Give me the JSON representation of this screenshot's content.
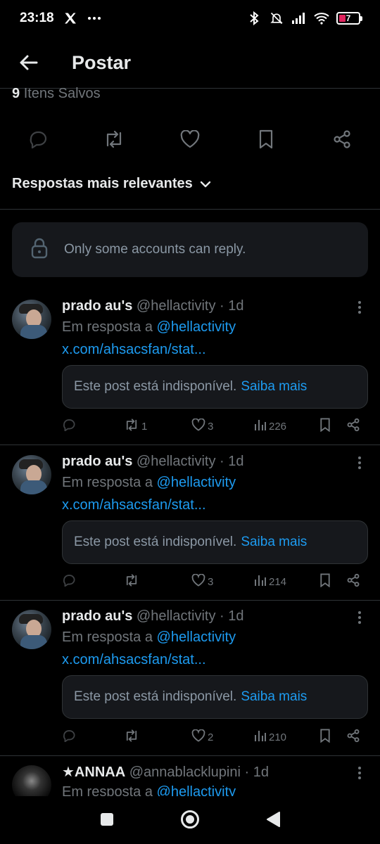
{
  "status_bar": {
    "time": "23:18",
    "battery_level": "7"
  },
  "header": {
    "title": "Postar"
  },
  "saved": {
    "count": "9",
    "label": "Itens Salvos"
  },
  "sort": {
    "label": "Respostas mais relevantes"
  },
  "restriction": {
    "text": "Only some accounts can reply."
  },
  "replies": [
    {
      "name": "prado au's",
      "handle": "@hellactivity",
      "dot": "·",
      "time": "1d",
      "reply_prefix": "Em resposta a",
      "reply_to": "@hellactivity",
      "link": "x.com/ahsacsfan/stat...",
      "unavailable_text": "Este post está indisponível.",
      "learn_more": "Saiba mais",
      "reposts": "1",
      "likes": "3",
      "views": "226"
    },
    {
      "name": "prado au's",
      "handle": "@hellactivity",
      "dot": "·",
      "time": "1d",
      "reply_prefix": "Em resposta a",
      "reply_to": "@hellactivity",
      "link": "x.com/ahsacsfan/stat...",
      "unavailable_text": "Este post está indisponível.",
      "learn_more": "Saiba mais",
      "reposts": "",
      "likes": "3",
      "views": "214"
    },
    {
      "name": "prado au's",
      "handle": "@hellactivity",
      "dot": "·",
      "time": "1d",
      "reply_prefix": "Em resposta a",
      "reply_to": "@hellactivity",
      "link": "x.com/ahsacsfan/stat...",
      "unavailable_text": "Este post está indisponível.",
      "learn_more": "Saiba mais",
      "reposts": "",
      "likes": "2",
      "views": "210"
    },
    {
      "name": "★ANNAA",
      "handle": "@annablacklupini",
      "dot": "·",
      "time": "1d",
      "reply_prefix": "Em resposta a",
      "reply_to": "@hellactivity"
    }
  ],
  "colors": {
    "background": "#000000",
    "accent": "#1d9bf0",
    "muted": "#71767b",
    "text": "#e7e9ea"
  }
}
